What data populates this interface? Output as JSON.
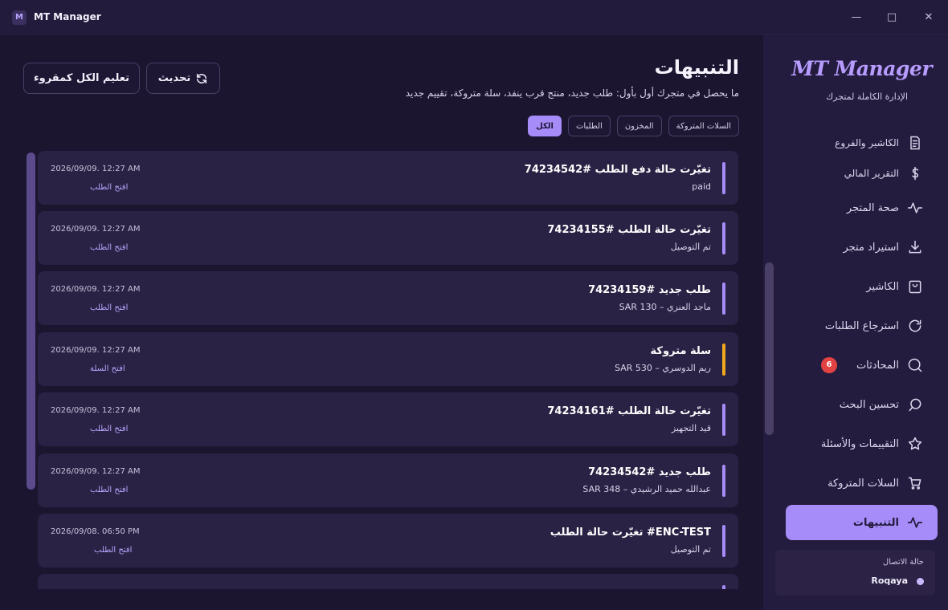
{
  "window": {
    "title": "MT Manager",
    "logo_letter": "M",
    "controls": [
      "—",
      "□",
      "✕"
    ]
  },
  "sidebar": {
    "brand": "MT Manager",
    "brand_subtitle": "الإدارة الكاملة لمتجرك",
    "items": [
      {
        "label": "الكاشير والفروع",
        "icon": "receipt-icon"
      },
      {
        "label": "التقرير المالي",
        "icon": "dollar-icon"
      },
      {
        "label": "صحة المتجر",
        "icon": "pulse-icon"
      },
      {
        "label": "استيراد متجر",
        "icon": "download-icon"
      },
      {
        "label": "الكاشير",
        "icon": "bag-icon"
      },
      {
        "label": "استرجاع الطلبات",
        "icon": "refresh-icon"
      },
      {
        "label": "المحادثات",
        "icon": "chat-icon",
        "badge": "6"
      },
      {
        "label": "تحسين البحث",
        "icon": "search-icon"
      },
      {
        "label": "التقييمات والأسئلة",
        "icon": "star-icon"
      },
      {
        "label": "السلات المتروكة",
        "icon": "cart-icon"
      },
      {
        "label": "التنبيهات",
        "icon": "pulse-icon",
        "active": true
      }
    ],
    "connection": {
      "title": "حالة الاتصال",
      "name": "Roqaya"
    }
  },
  "header": {
    "title": "التنبيهات",
    "description": "ما يحصل في متجرك أول بأول: طلب جديد، منتج قرب ينفد، سلة متروكة، تقييم جديد",
    "refresh_label": "تحديث",
    "mark_all_label": "تعليم الكل كمقروء"
  },
  "filters": [
    "الكل",
    "الطلبات",
    "المخزون",
    "السلات المتروكة"
  ],
  "notifications": [
    {
      "title": "تغيّرت حالة دفع الطلب #74234542",
      "subtitle": "paid",
      "time": "2026/09/09. 12:27 AM",
      "link": "افتح الطلب",
      "kind": "order"
    },
    {
      "title": "تغيّرت حالة الطلب #74234155",
      "subtitle": "تم التوصيل",
      "time": "2026/09/09. 12:27 AM",
      "link": "افتح الطلب",
      "kind": "order"
    },
    {
      "title": "طلب جديد #74234159",
      "subtitle": "SAR 130 – ماجد العنزي",
      "time": "2026/09/09. 12:27 AM",
      "link": "افتح الطلب",
      "kind": "order"
    },
    {
      "title": "سلة متروكة",
      "subtitle": "SAR 530 – ريم الدوسري",
      "time": "2026/09/09. 12:27 AM",
      "link": "افتح السلة",
      "kind": "cart"
    },
    {
      "title": "تغيّرت حالة الطلب #74234161",
      "subtitle": "قيد التجهيز",
      "time": "2026/09/09. 12:27 AM",
      "link": "افتح الطلب",
      "kind": "order"
    },
    {
      "title": "طلب جديد #74234542",
      "subtitle": "SAR 348 – عبدالله حميد الرشيدي",
      "time": "2026/09/09. 12:27 AM",
      "link": "افتح الطلب",
      "kind": "order"
    },
    {
      "title": "تغيّرت حالة الطلب #ENC-TEST",
      "subtitle": "تم التوصيل",
      "time": "2026/09/08. 06:50 PM",
      "link": "افتح الطلب",
      "kind": "order"
    }
  ],
  "colors": {
    "accent": "#a68cf8",
    "warning": "#f1a81c",
    "badge": "#e34242"
  }
}
